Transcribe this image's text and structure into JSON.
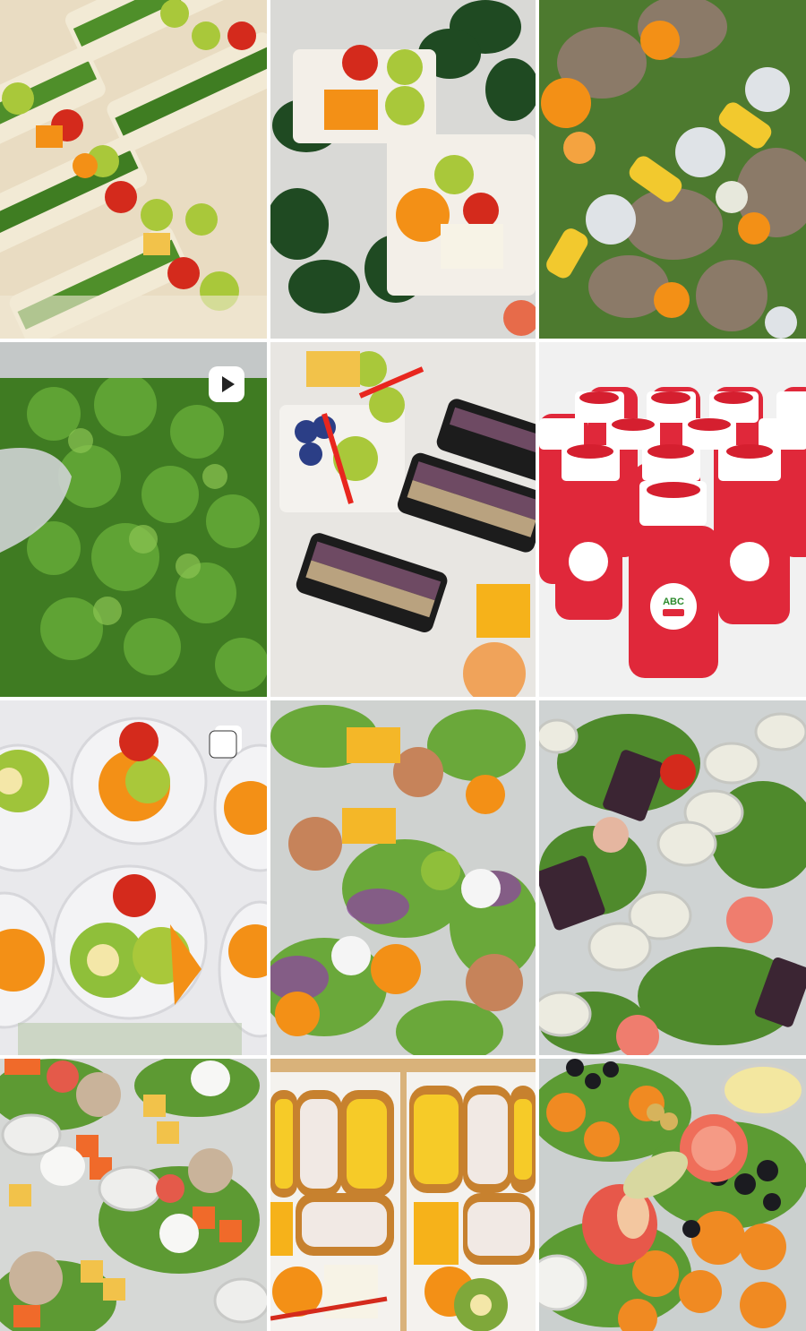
{
  "grid": {
    "tiles": [
      {
        "subject": "sandwiches-with-fruit-cups",
        "badge": null
      },
      {
        "subject": "leaf-wraps-with-fruit-trays",
        "badge": null
      },
      {
        "subject": "meat-orange-corn-boxes",
        "badge": null
      },
      {
        "subject": "broccoli-in-steel-tray",
        "badge": "video-icon"
      },
      {
        "subject": "kimbap-sandwiches-with-berries",
        "badge": null
      },
      {
        "subject": "red-juice-bottles",
        "badge": null
      },
      {
        "subject": "fruit-cups-with-lids",
        "badge": "carousel-icon"
      },
      {
        "subject": "salad-boxes-with-eggs",
        "badge": null
      },
      {
        "subject": "salad-boxes-with-dressing",
        "badge": null
      },
      {
        "subject": "salad-boxes-egg-carrot",
        "badge": null
      },
      {
        "subject": "inari-sushi-boxes",
        "badge": null
      },
      {
        "subject": "fried-chicken-salad",
        "badge": null
      }
    ]
  },
  "labels": {
    "juice_label_line1": "ABC"
  },
  "colors": {
    "tile_gap": "#ffffff",
    "bread": "#f2ead5",
    "lettuce": "#4f8f2a",
    "orange": "#f39016",
    "tomato": "#d42a1c",
    "grape": "#a9c83a",
    "juice": "#e0283a",
    "steel": "#b9bdbd"
  }
}
